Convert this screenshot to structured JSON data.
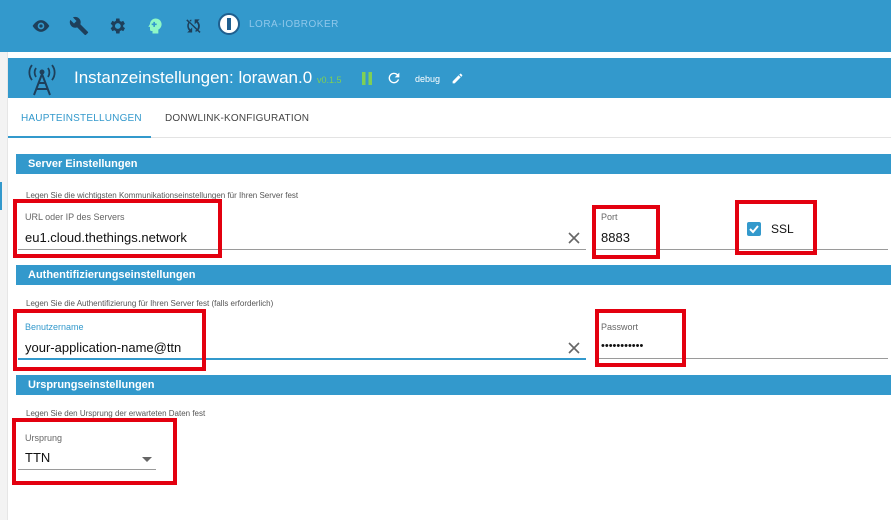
{
  "topbar": {
    "icons": [
      "eye-icon",
      "wrench-icon",
      "gear-icon",
      "brain-icon",
      "sync-off-icon"
    ],
    "brand": "LORA-IOBROKER"
  },
  "panel": {
    "title": "Instanzeinstellungen: lorawan.0",
    "version": "v0.1.5",
    "loglevel": "debug"
  },
  "tabs": [
    {
      "label": "HAUPTEINSTELLUNGEN"
    },
    {
      "label": "DONWLINK-KONFIGURATION"
    }
  ],
  "sections": {
    "server": {
      "title": "Server Einstellungen",
      "desc": "Legen Sie die wichtigsten Kommunikationseinstellungen für Ihren Server fest",
      "url_label": "URL oder IP des Servers",
      "url_value": "eu1.cloud.thethings.network",
      "port_label": "Port",
      "port_value": "8883",
      "ssl_label": "SSL",
      "ssl_checked": true
    },
    "auth": {
      "title": "Authentifizierungseinstellungen",
      "desc": "Legen Sie die Authentifizierung für Ihren Server fest (falls erforderlich)",
      "user_label": "Benutzername",
      "user_value": "your-application-name@ttn",
      "pass_label": "Passwort",
      "pass_value": "•••••••••••"
    },
    "origin": {
      "title": "Ursprungseinstellungen",
      "desc": "Legen Sie den Ursprung der erwarteten Daten fest",
      "origin_label": "Ursprung",
      "origin_value": "TTN"
    }
  },
  "colors": {
    "primary": "#3399cc",
    "annotation": "#e3000f",
    "version": "#7fcf55"
  }
}
